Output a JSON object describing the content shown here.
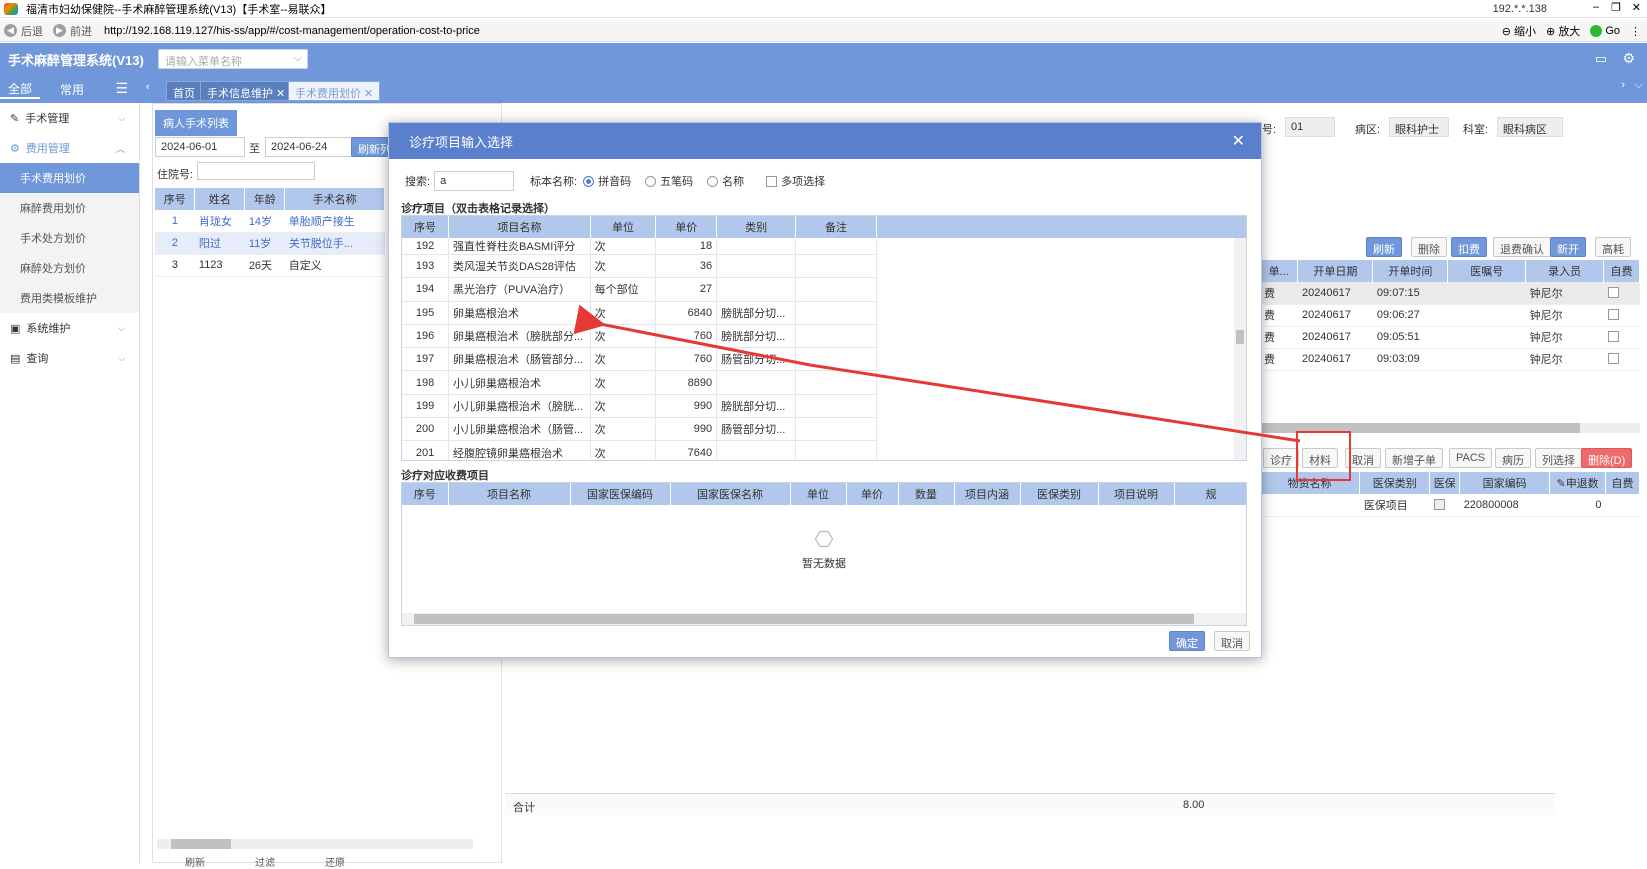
{
  "window": {
    "title": "福清市妇幼保健院--手术麻醉管理系统(V13)【手术室--易联众】",
    "ip": "192.*.*.138",
    "minimize": "–",
    "restore": "❐",
    "close": "✕"
  },
  "nav": {
    "back": "后退",
    "forward": "前进",
    "url": "http://192.168.119.127/his-ss/app/#/cost-management/operation-cost-to-price",
    "zoom_out": "缩小",
    "zoom_in": "放大",
    "go": "Go"
  },
  "app": {
    "name": "手术麻醉管理系统(V13)",
    "menu_search_placeholder": "请输入菜单名称"
  },
  "side_tabs": {
    "all": "全部",
    "common": "常用"
  },
  "page_tabs": [
    "首页",
    "手术信息维护",
    "手术费用划价"
  ],
  "sidebar": {
    "surgery_mgmt": "手术管理",
    "fee_mgmt": "费用管理",
    "sub": [
      "手术费用划价",
      "麻醉费用划价",
      "手术处方划价",
      "麻醉处方划价",
      "费用类模板维护"
    ],
    "sys_maint": "系统维护",
    "query": "查询"
  },
  "patient_panel": {
    "header": "病人手术列表",
    "date_from": "2024-06-01",
    "to": "至",
    "date_to": "2024-06-24",
    "refresh": "刷新列",
    "inpatient_label": "住院号:",
    "columns": [
      "序号",
      "姓名",
      "年龄",
      "手术名称"
    ],
    "rows": [
      [
        "1",
        "肖珑女",
        "14岁",
        "单胎顺产接生"
      ],
      [
        "2",
        "阳过",
        "11岁",
        "关节脱位手..."
      ],
      [
        "3",
        "1123",
        "26天",
        "自定义"
      ]
    ]
  },
  "right_header": {
    "no_value": "01",
    "ward_label": "病区:",
    "ward_value": "眼科护士站",
    "dept_label": "科室:",
    "dept_value": "眼科病区",
    "no_suffix": "号:"
  },
  "top_buttons": [
    "刷新",
    "删除",
    "扣费",
    "退费确认",
    "新开",
    "高耗"
  ],
  "orders_table": {
    "columns": [
      "单...",
      "开单日期",
      "开单时间",
      "医嘱号",
      "录入员",
      "自费"
    ],
    "rows": [
      [
        "费",
        "20240617",
        "09:07:15",
        "",
        "钟尼尔"
      ],
      [
        "费",
        "20240617",
        "09:06:27",
        "",
        "钟尼尔"
      ],
      [
        "费",
        "20240617",
        "09:05:51",
        "",
        "钟尼尔"
      ],
      [
        "费",
        "20240617",
        "09:03:09",
        "",
        "钟尼尔"
      ]
    ]
  },
  "mid_buttons": [
    "诊疗",
    "材料",
    "取消",
    "新增子单",
    "PACS",
    "病历",
    "列选择",
    "删除(D)"
  ],
  "detail_table": {
    "columns": [
      "物资名称",
      "医保类别",
      "医保",
      "国家编码",
      "申退数",
      "自费"
    ],
    "row": [
      "",
      "医保项目",
      "",
      "220800008",
      "0"
    ]
  },
  "footer": {
    "total_label": "合计",
    "total_value": "8.00"
  },
  "left_footer_buttons": [
    "刷新",
    "过滤",
    "还原"
  ],
  "modal": {
    "title": "诊疗项目输入选择",
    "search_label": "搜索:",
    "search_value": "a",
    "std_name_label": "标本名称:",
    "opt_pinyin": "拼音码",
    "opt_wubi": "五笔码",
    "opt_name": "名称",
    "opt_multi": "多项选择",
    "section1": "诊疗项目（双击表格记录选择）",
    "section2": "诊疗对应收费项目",
    "grid1_columns": [
      "序号",
      "项目名称",
      "单位",
      "单价",
      "类别",
      "备注"
    ],
    "grid1_rows": [
      [
        "192",
        "强直性脊柱炎BASMI评分",
        "次",
        "18",
        "",
        ""
      ],
      [
        "193",
        "类风湿关节炎DAS28评估",
        "次",
        "36",
        "",
        ""
      ],
      [
        "194",
        "黑光治疗（PUVA治疗）",
        "每个部位",
        "27",
        "",
        ""
      ],
      [
        "195",
        "卵巢癌根治术",
        "次",
        "6840",
        "膀胱部分切...",
        ""
      ],
      [
        "196",
        "卵巢癌根治术（膀胱部分...",
        "次",
        "760",
        "膀胱部分切...",
        ""
      ],
      [
        "197",
        "卵巢癌根治术（肠管部分...",
        "次",
        "760",
        "肠管部分切...",
        ""
      ],
      [
        "198",
        "小儿卵巢癌根治术",
        "次",
        "8890",
        "",
        ""
      ],
      [
        "199",
        "小儿卵巢癌根治术（膀胱...",
        "次",
        "990",
        "膀胱部分切...",
        ""
      ],
      [
        "200",
        "小儿卵巢癌根治术（肠管...",
        "次",
        "990",
        "肠管部分切...",
        ""
      ],
      [
        "201",
        "经腹腔镜卵巢癌根治术",
        "次",
        "7640",
        "",
        ""
      ]
    ],
    "grid2_columns": [
      "序号",
      "项目名称",
      "国家医保编码",
      "国家医保名称",
      "单位",
      "单价",
      "数量",
      "项目内涵",
      "医保类别",
      "项目说明",
      "规"
    ],
    "empty_text": "暂无数据",
    "ok": "确定",
    "cancel": "取消"
  },
  "colors": {
    "primary": "#6f97d9",
    "header_blue": "#5a7fcd",
    "table_header": "#b2c7ec",
    "annotation_red": "#e53935"
  }
}
